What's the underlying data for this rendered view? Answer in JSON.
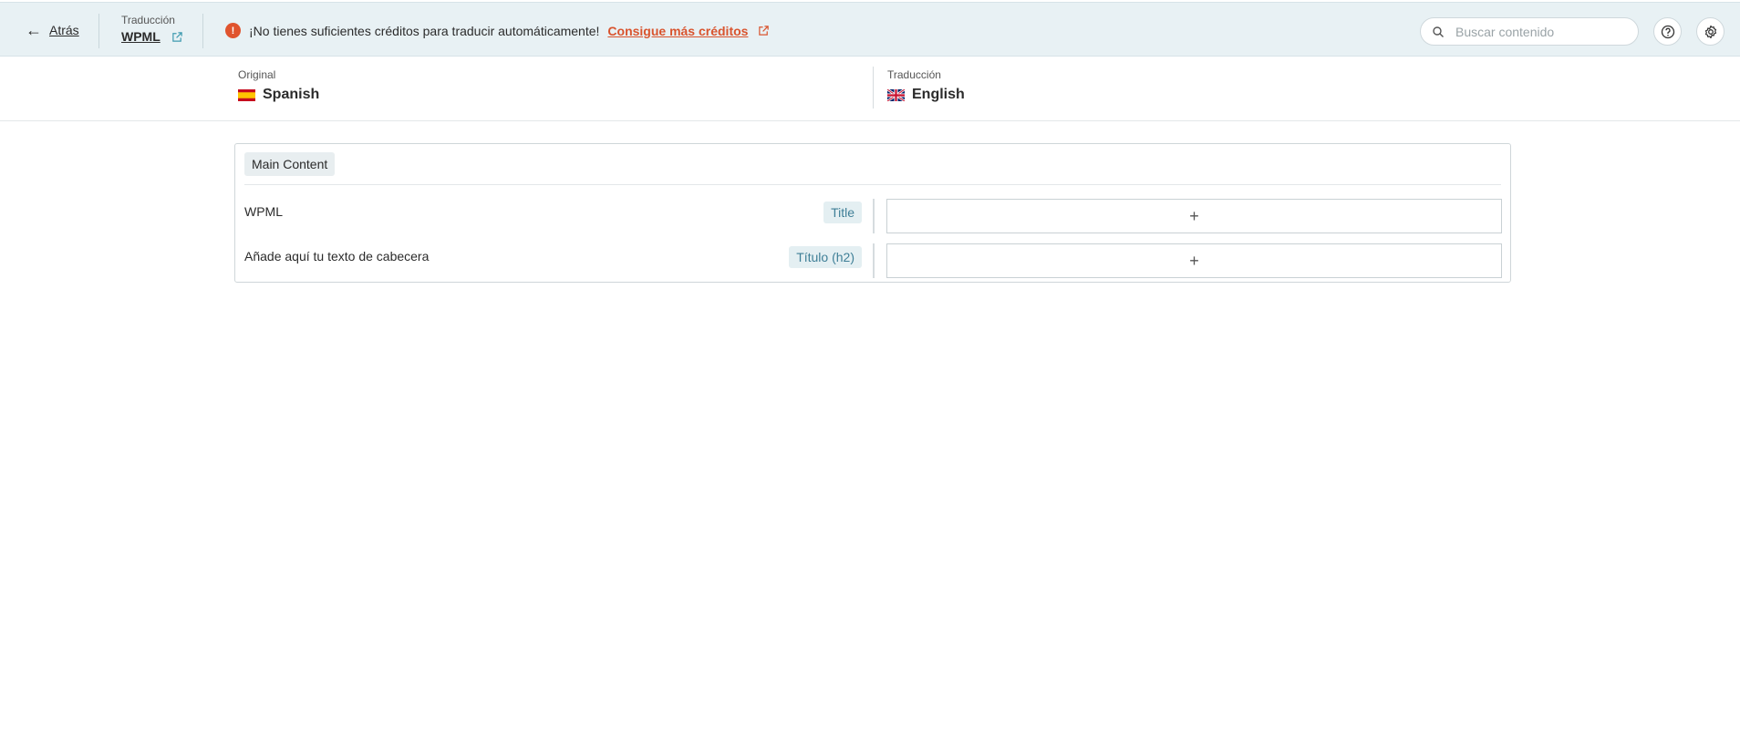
{
  "header": {
    "back_label": "Atrás",
    "translation_caption": "Traducción",
    "document_title": "WPML",
    "alert": {
      "message": "¡No tienes suficientes créditos para traducir automáticamente!",
      "link": "Consigue más créditos"
    },
    "search": {
      "placeholder": "Buscar contenido",
      "value": ""
    }
  },
  "languages": {
    "original": {
      "caption": "Original",
      "name": "Spanish"
    },
    "translation": {
      "caption": "Traducción",
      "name": "English"
    }
  },
  "content": {
    "section_label": "Main Content",
    "rows": [
      {
        "source": "WPML",
        "type": "Title",
        "target": ""
      },
      {
        "source": "Añade aquí tu texto de cabecera",
        "type": "Título (h2)",
        "target": ""
      }
    ],
    "add_symbol": "+"
  },
  "colors": {
    "accent": "#d9542e",
    "topbar_bg": "#e8f1f4",
    "tag_text": "#3f7f97"
  }
}
